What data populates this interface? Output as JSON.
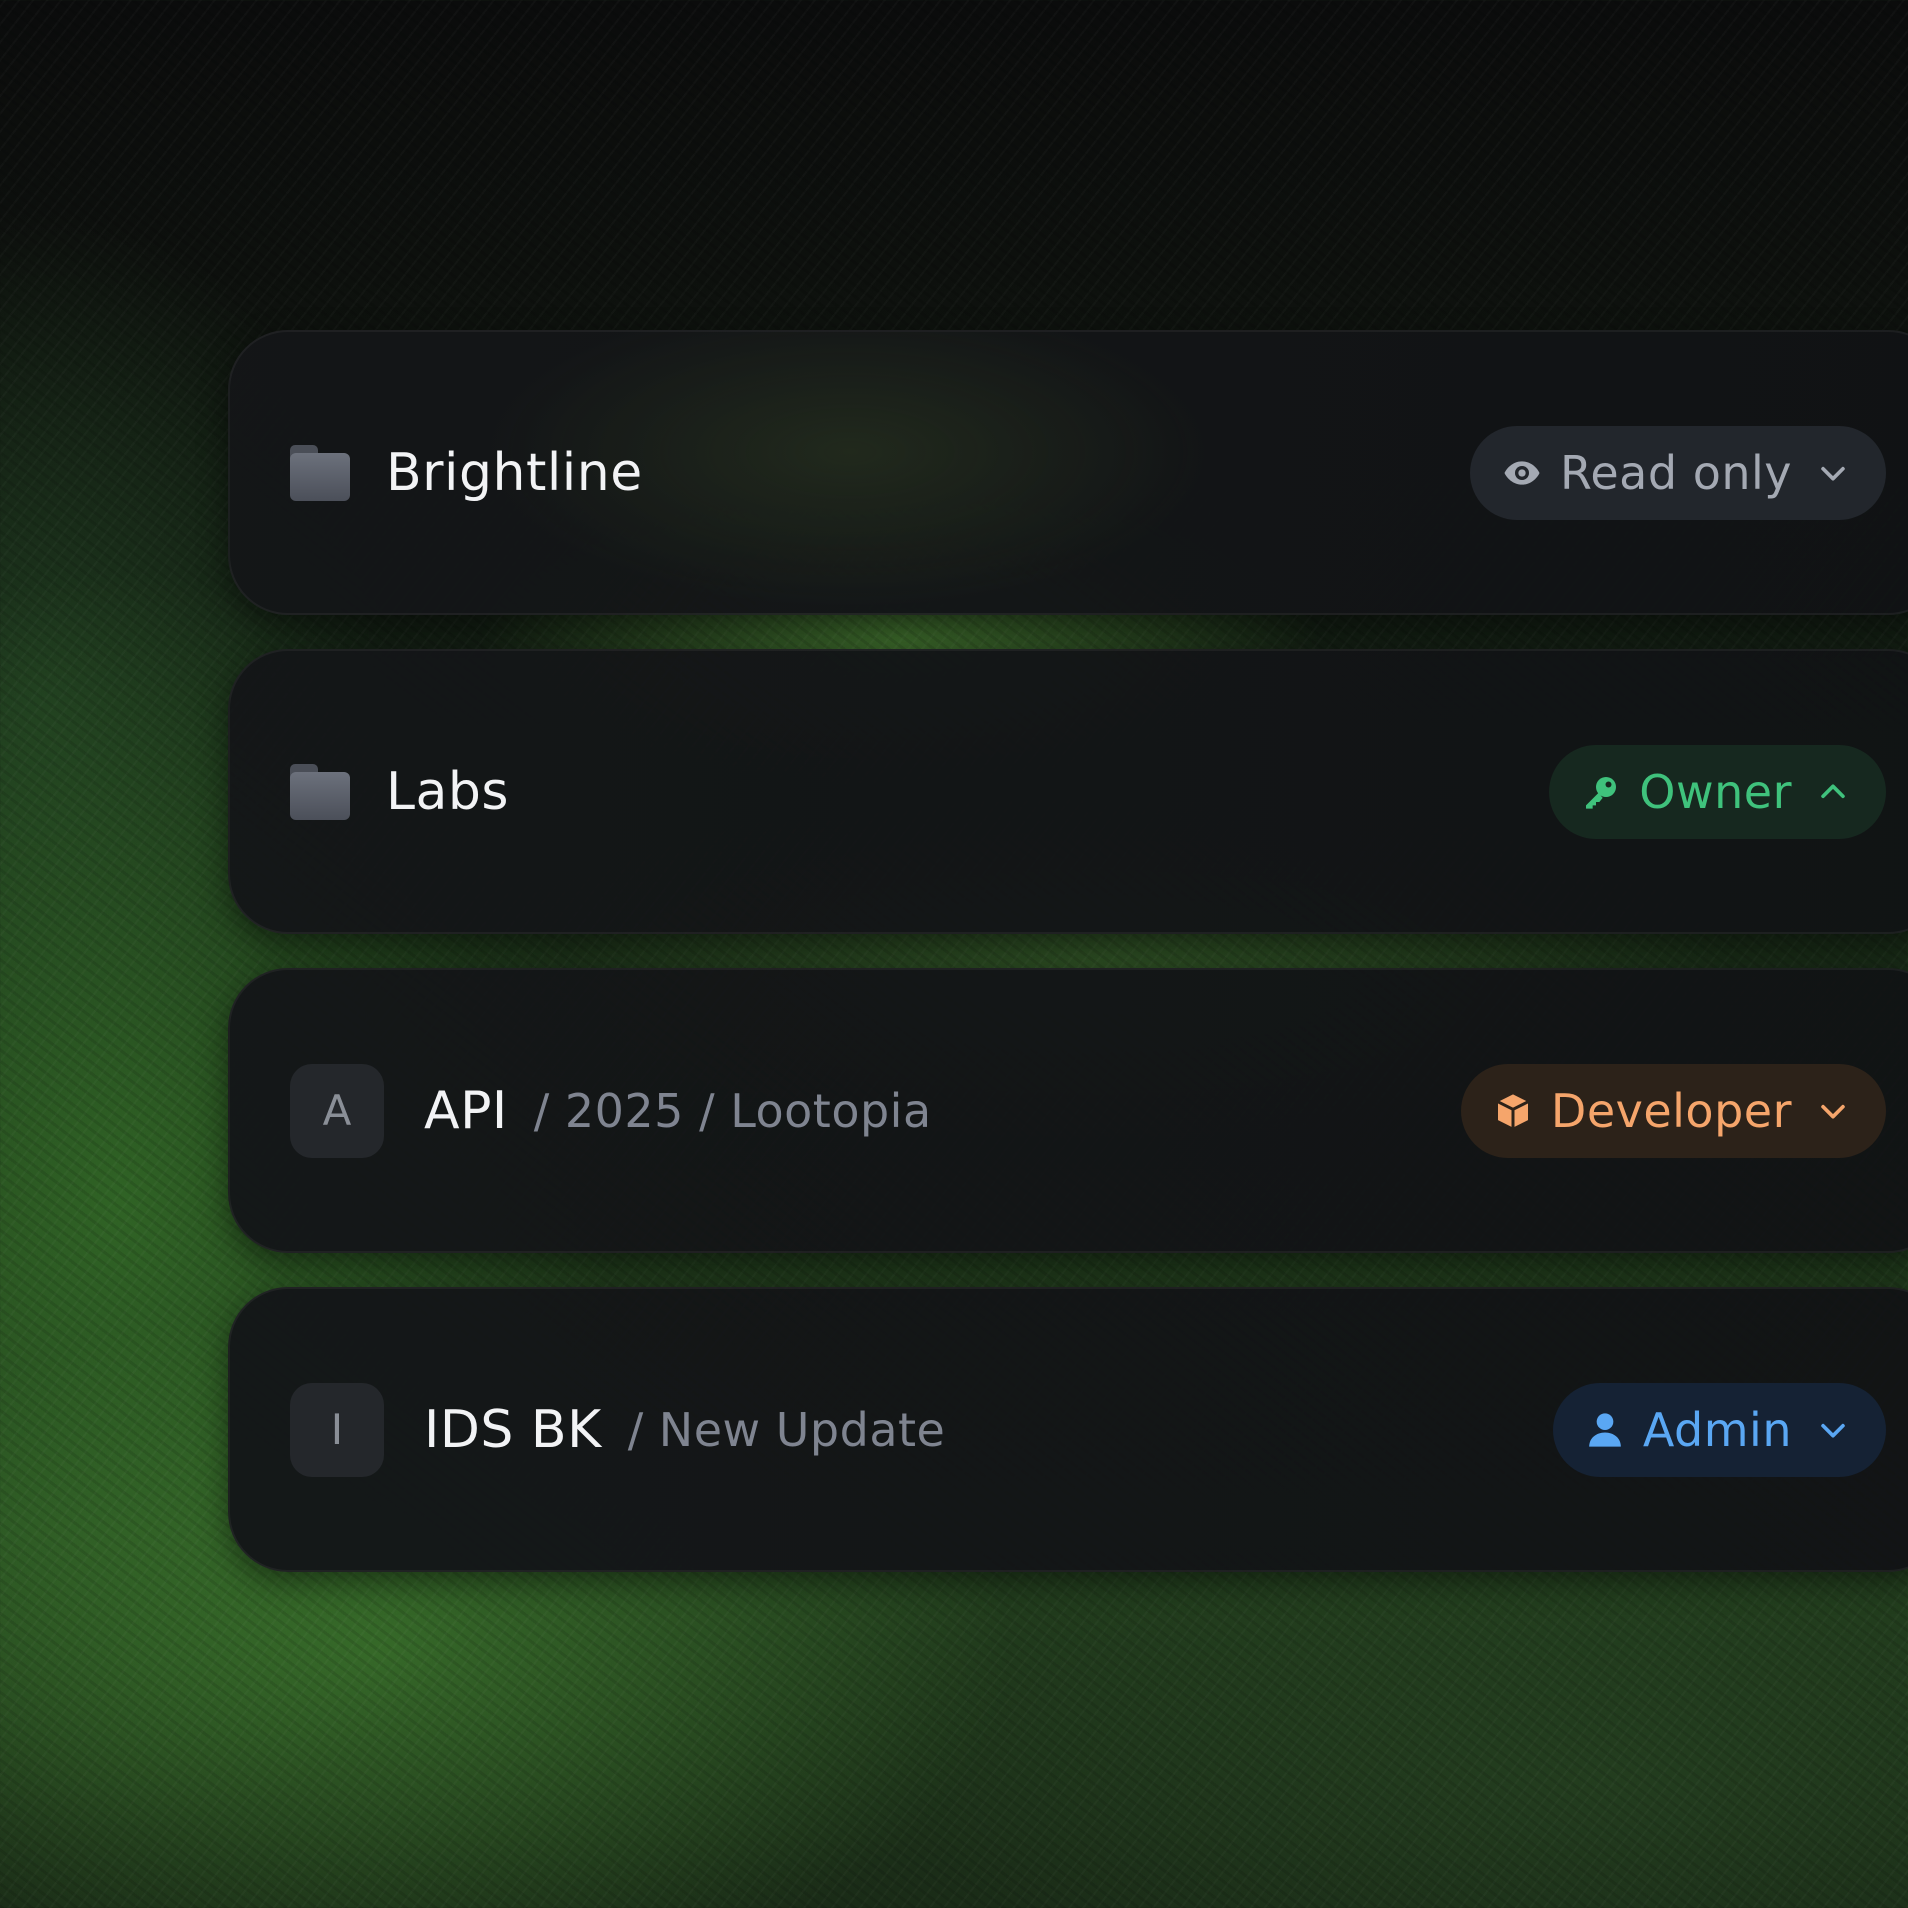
{
  "rows": [
    {
      "kind": "folder",
      "title": "Brightline",
      "crumb": "",
      "role": {
        "label": "Read only",
        "icon": "eye-icon",
        "chevron": "chevron-down-icon",
        "color": "#a4a9b3"
      }
    },
    {
      "kind": "folder",
      "title": "Labs",
      "crumb": "",
      "role": {
        "label": "Owner",
        "icon": "key-icon",
        "chevron": "chevron-up-icon",
        "color": "#3fc27c"
      }
    },
    {
      "kind": "avatar",
      "avatar": "A",
      "title": "API",
      "crumb": "/ 2025 / Lootopia",
      "role": {
        "label": "Developer",
        "icon": "cube-icon",
        "chevron": "chevron-down-icon",
        "color": "#f5a56b"
      }
    },
    {
      "kind": "avatar",
      "avatar": "I",
      "title": "IDS BK",
      "crumb": "/ New Update",
      "role": {
        "label": "Admin",
        "icon": "user-icon",
        "chevron": "chevron-down-icon",
        "color": "#5aa7f3"
      }
    }
  ]
}
